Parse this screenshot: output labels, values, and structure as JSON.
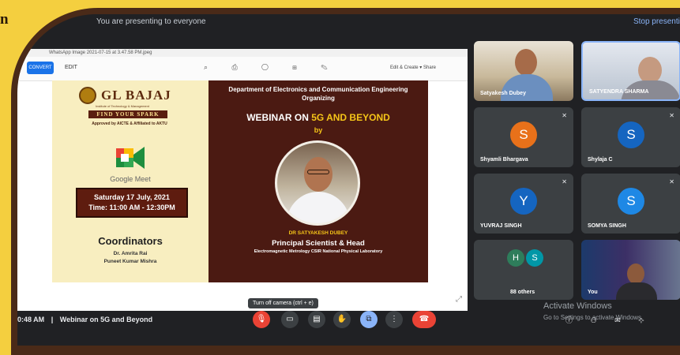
{
  "corner_text": "n",
  "meet": {
    "header_left": "You are presenting to everyone",
    "header_right": "Stop presenting"
  },
  "viewer": {
    "filename_tab": "WhatsApp Image 2021-07-15 at 3.47.58 PM.jpeg",
    "blue_button": "CONVERT",
    "file_label": "EDIT",
    "toolbar_icons": "⌕ ⎙ ◯ ⊞ ✎",
    "right_actions": "Edit & Create ▾   Share"
  },
  "slide_left": {
    "logo_text": "GL BAJAJ",
    "logo_sub": "Institute of Technology & Management",
    "tagline": "FIND YOUR SPARK",
    "approval": "Approved by AICTE & Affiliated to AKTU",
    "meet_label": "Google Meet",
    "date_line1": "Saturday 17 July, 2021",
    "date_line2": "Time: 11:00 AM - 12:30PM",
    "coordinators_title": "Coordinators",
    "coordinators": [
      "Dr. Amrita Rai",
      "Puneet Kumar Mishra"
    ]
  },
  "slide_right": {
    "department": "Department of Electronics and Communication Engineering Organizing",
    "webinar_prefix": "WEBINAR ON ",
    "webinar_topic": "5G AND BEYOND",
    "by": "by",
    "speaker_name": "DR SATYAKESH DUBEY",
    "speaker_role": "Principal Scientist & Head",
    "speaker_lab": "Electromagnetic Metrology CSIR National Physical Laboratory"
  },
  "tiles": [
    {
      "name": "Satyakesh Dubey",
      "type": "video"
    },
    {
      "name": "SATYENDRA SHARMA",
      "type": "video"
    },
    {
      "name": "Shyamli Bhargava",
      "initial": "S",
      "color": "#e8711a"
    },
    {
      "name": "Shylaja C",
      "initial": "S",
      "color": "#1565c0"
    },
    {
      "name": "YUVRAJ SINGH",
      "initial": "Y",
      "color": "#1565c0"
    },
    {
      "name": "SOMYA SINGH",
      "initial": "S",
      "color": "#1e88e5"
    },
    {
      "name": "88 others",
      "initials": [
        "H",
        "S"
      ],
      "colors": [
        "#2e7d5b",
        "#0097a7"
      ]
    },
    {
      "name": "You",
      "type": "video"
    }
  ],
  "bottom": {
    "tooltip": "Turn off camera (ctrl + e)",
    "time": "0:48 AM",
    "separator": "|",
    "meeting_title": "Webinar on 5G and Beyond",
    "activate_title": "Activate Windows",
    "activate_sub": "Go to Settings to activate Windows.",
    "controls": [
      {
        "name": "mic",
        "glyph": "🎙"
      },
      {
        "name": "camera",
        "glyph": "▭"
      },
      {
        "name": "captions",
        "glyph": "▤"
      },
      {
        "name": "raise-hand",
        "glyph": "✋"
      },
      {
        "name": "present",
        "glyph": "⧉"
      },
      {
        "name": "more",
        "glyph": "⋮"
      },
      {
        "name": "end-call",
        "glyph": "☎"
      }
    ],
    "right_icons": "ⓘ ⚇ ✉ ⊹"
  }
}
